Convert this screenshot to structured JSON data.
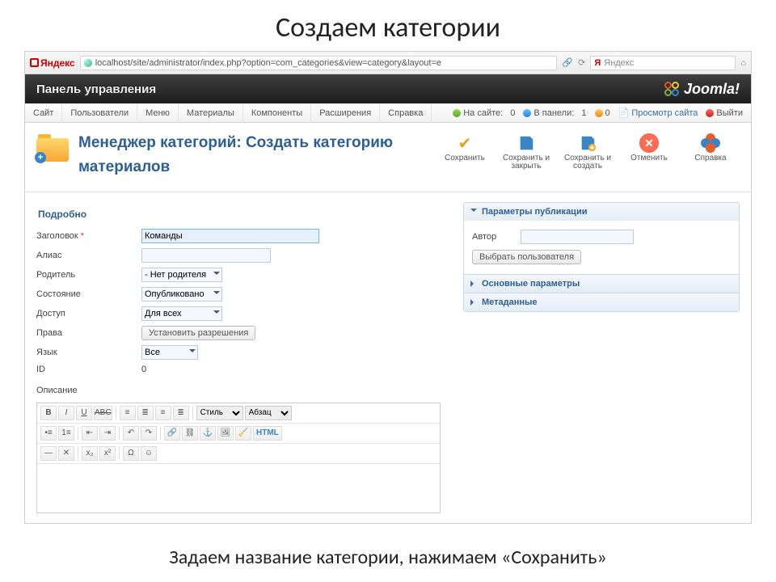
{
  "slide": {
    "title": "Создаем категории",
    "caption": "Задаем название категории, нажимаем «Сохранить»"
  },
  "browser": {
    "brand": "Яндекс",
    "url": "localhost/site/administrator/index.php?option=com_categories&view=category&layout=e",
    "search_placeholder": "Яндекс"
  },
  "header": {
    "panel": "Панель управления",
    "logo": "Joomla!"
  },
  "menubar": {
    "items": [
      "Сайт",
      "Пользователи",
      "Меню",
      "Материалы",
      "Компоненты",
      "Расширения",
      "Справка"
    ],
    "status": {
      "on_site_label": "На сайте:",
      "on_site": "0",
      "in_panel_label": "В панели:",
      "in_panel": "1",
      "msgs": "0",
      "preview": "Просмотр сайта",
      "logout": "Выйти"
    }
  },
  "page": {
    "title": "Менеджер категорий: Создать категорию материалов"
  },
  "toolbar": {
    "save": "Сохранить",
    "save_close": "Сохранить и закрыть",
    "save_new": "Сохранить и создать",
    "cancel": "Отменить",
    "help": "Справка"
  },
  "form": {
    "legend": "Подробно",
    "title_label": "Заголовок",
    "title_value": "Команды",
    "alias_label": "Алиас",
    "alias_value": "",
    "parent_label": "Родитель",
    "parent_value": "- Нет родителя -",
    "state_label": "Состояние",
    "state_value": "Опубликовано",
    "access_label": "Доступ",
    "access_value": "Для всех",
    "perms_label": "Права",
    "perms_btn": "Установить разрешения",
    "lang_label": "Язык",
    "lang_value": "Все",
    "id_label": "ID",
    "id_value": "0",
    "desc_label": "Описание"
  },
  "editor": {
    "style": "Стиль",
    "para": "Абзац",
    "html": "HTML"
  },
  "sidepanels": {
    "pub": "Параметры публикации",
    "author_label": "Автор",
    "author_value": "",
    "select_user": "Выбрать пользователя",
    "basic": "Основные параметры",
    "meta": "Метаданные"
  }
}
